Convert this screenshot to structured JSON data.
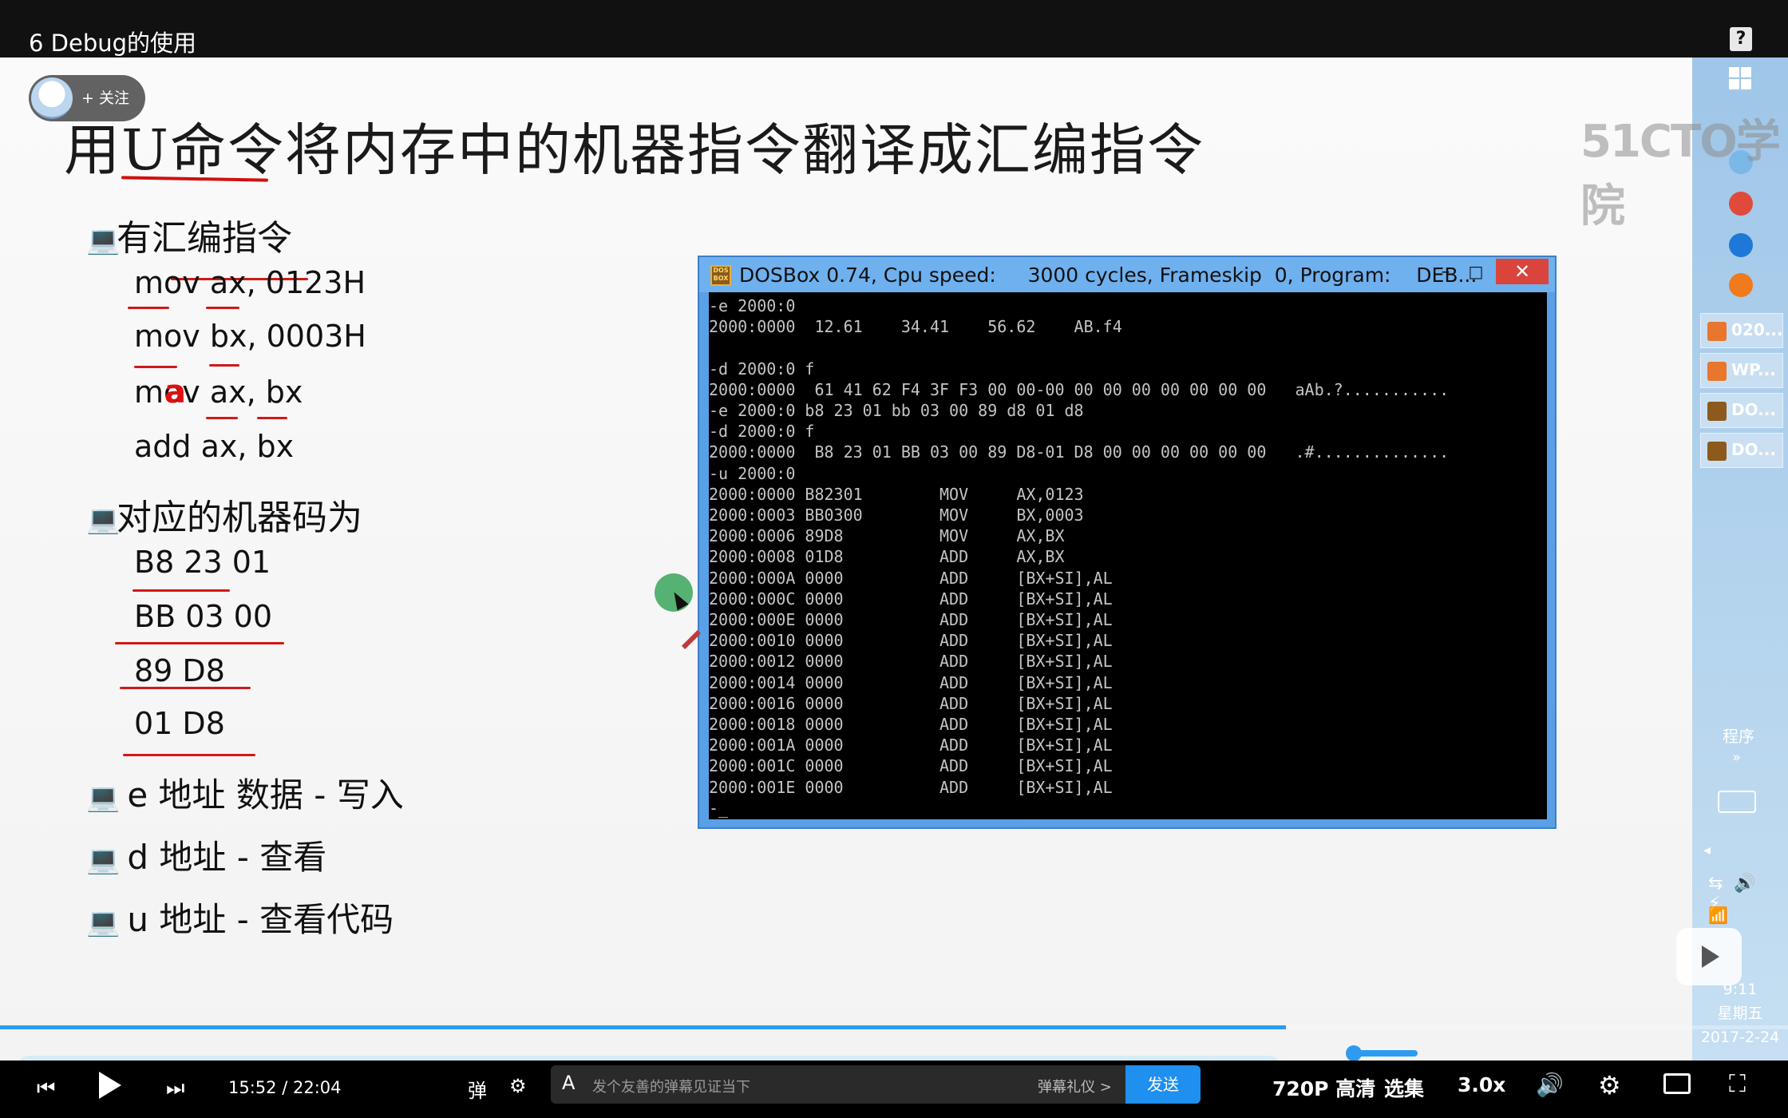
{
  "video": {
    "title": "6 Debug的使用",
    "help_icon": "?"
  },
  "uploader": {
    "follow_label": "+ 关注"
  },
  "slide": {
    "title": "用U命令将内存中的机器指令翻译成汇编指令",
    "sections": [
      {
        "bullet": "💻",
        "label": "有汇编指令",
        "lines": [
          "mov ax, 0123H",
          "mov bx, 0003H",
          "mov ax, bx",
          "add ax, bx"
        ]
      },
      {
        "bullet": "💻",
        "label": "对应的机器码为",
        "lines": [
          "B8 23 01",
          "BB 03 00",
          "89 D8",
          "01 D8"
        ]
      }
    ],
    "commands": [
      {
        "bullet": "💻",
        "text": "e 地址 数据 - 写入"
      },
      {
        "bullet": "💻",
        "text": "d 地址 - 查看"
      },
      {
        "bullet": "💻",
        "text": "u 地址 - 查看代码"
      }
    ],
    "annotation_mark": "a"
  },
  "dosbox": {
    "title": "DOSBox 0.74, Cpu speed:     3000 cycles, Frameskip  0, Program:    DEB...",
    "minimize": "–",
    "maximize": "□",
    "close": "✕",
    "icon_label": "DOS BOX",
    "screen_lines": [
      "-e 2000:0",
      "2000:0000  12.61    34.41    56.62    AB.f4",
      "",
      "-d 2000:0 f",
      "2000:0000  61 41 62 F4 3F F3 00 00-00 00 00 00 00 00 00 00   aAb.?...........",
      "-e 2000:0 b8 23 01 bb 03 00 89 d8 01 d8",
      "-d 2000:0 f",
      "2000:0000  B8 23 01 BB 03 00 89 D8-01 D8 00 00 00 00 00 00   .#..............",
      "-u 2000:0",
      "2000:0000 B82301        MOV     AX,0123",
      "2000:0003 BB0300        MOV     BX,0003",
      "2000:0006 89D8          MOV     AX,BX",
      "2000:0008 01D8          ADD     AX,BX",
      "2000:000A 0000          ADD     [BX+SI],AL",
      "2000:000C 0000          ADD     [BX+SI],AL",
      "2000:000E 0000          ADD     [BX+SI],AL",
      "2000:0010 0000          ADD     [BX+SI],AL",
      "2000:0012 0000          ADD     [BX+SI],AL",
      "2000:0014 0000          ADD     [BX+SI],AL",
      "2000:0016 0000          ADD     [BX+SI],AL",
      "2000:0018 0000          ADD     [BX+SI],AL",
      "2000:001A 0000          ADD     [BX+SI],AL",
      "2000:001C 0000          ADD     [BX+SI],AL",
      "2000:001E 0000          ADD     [BX+SI],AL",
      "-_"
    ]
  },
  "taskbar": {
    "watermark": "51CTO学院",
    "items": [
      {
        "label": "020...",
        "icon": "wps-presentation-icon",
        "color": "#e8762c"
      },
      {
        "label": "WP...",
        "icon": "wps-presentation-icon",
        "color": "#e8762c"
      },
      {
        "label": "DO...",
        "icon": "dosbox-icon",
        "color": "#8b5a1c"
      },
      {
        "label": "DO...",
        "icon": "dosbox-icon",
        "color": "#8b5a1c"
      }
    ],
    "program_label": "程序",
    "program_arrow": "»",
    "clock_time": "9:11",
    "clock_weekday": "星期五",
    "clock_date": "2017-2-24",
    "tray_arrow": "◂",
    "tray_icons": "⇆🔊⚡",
    "signal": "📶"
  },
  "player": {
    "current_time": "15:52",
    "separator": "/",
    "total_time": "22:04",
    "progress_percent": 71.9,
    "danmaku_placeholder": "发个友善的弹幕见证当下",
    "danmaku_etiquette": "弹幕礼仪 >",
    "send_label": "发送",
    "quality_label": "720P 高清",
    "episodes_label": "选集",
    "speed_label": "3.0x",
    "danmaku_a": "A",
    "prev_icon": "⏮",
    "next_icon": "⏭",
    "volume_icon": "🔊",
    "settings_icon": "⚙",
    "fullscreen_icon": "⛶",
    "danmaku_toggle_icon": "弹",
    "danmaku_setting_icon": "⚙"
  },
  "colors": {
    "accent_blue": "#2d9cf0",
    "underline_red": "#d01818",
    "dos_text": "#c4c4c4",
    "dos_titlebar": "#6fb0ee"
  }
}
